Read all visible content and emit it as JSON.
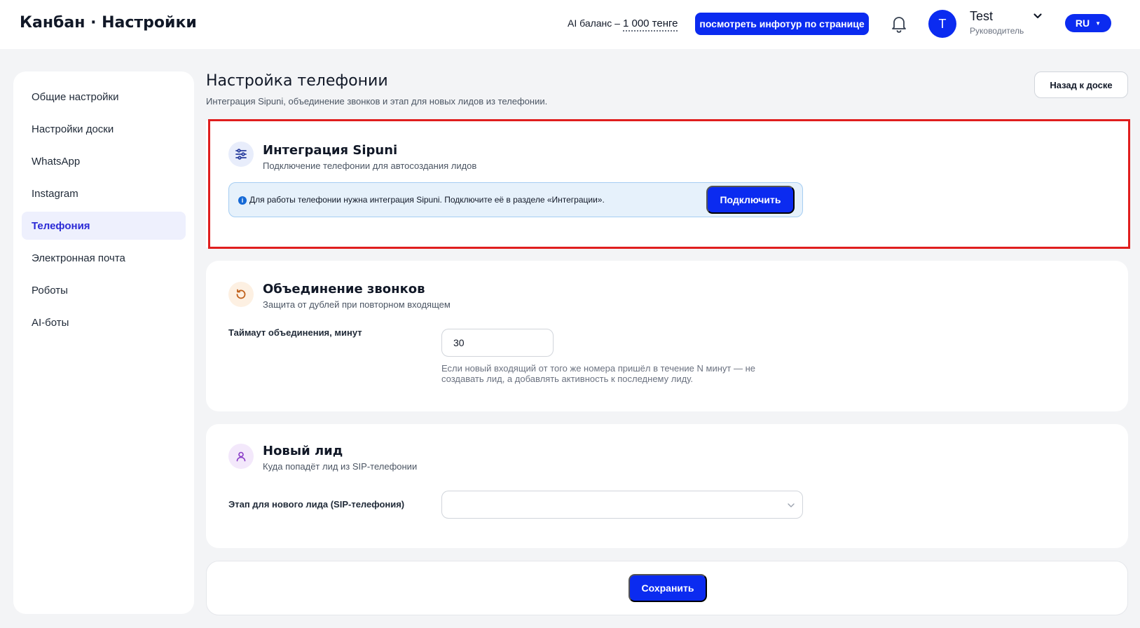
{
  "header": {
    "app_title": "Канбан · Настройки",
    "ai_balance_label": "AI баланс –",
    "ai_balance_value": "1 000 тенге",
    "tour_button": "посмотреть инфотур по странице",
    "user": {
      "initial": "T",
      "name": "Test",
      "role": "Руководитель"
    },
    "language": "RU"
  },
  "sidebar": {
    "items": [
      {
        "label": "Общие настройки"
      },
      {
        "label": "Настройки доски"
      },
      {
        "label": "WhatsApp"
      },
      {
        "label": "Instagram"
      },
      {
        "label": "Телефония",
        "active": true
      },
      {
        "label": "Электронная почта"
      },
      {
        "label": "Роботы"
      },
      {
        "label": "AI-боты"
      }
    ]
  },
  "main": {
    "title": "Настройка телефонии",
    "subtitle": "Интеграция Sipuni, объединение звонков и этап для новых лидов из телефонии.",
    "back_button": "Назад к доске",
    "sipuni": {
      "title": "Интеграция Sipuni",
      "subtitle": "Подключение телефонии для автосоздания лидов",
      "info_text": "Для работы телефонии нужна интеграция Sipuni. Подключите её в разделе «Интеграции».",
      "connect_button": "Подключить"
    },
    "merge": {
      "title": "Объединение звонков",
      "subtitle": "Защита от дублей при повторном входящем",
      "field_label": "Таймаут объединения, минут",
      "value": "30",
      "hint": "Если новый входящий от того же номера пришёл в течение N минут — не создавать лид, а добавлять активность к последнему лиду."
    },
    "new_lead": {
      "title": "Новый лид",
      "subtitle": "Куда попадёт лид из SIP-телефонии",
      "field_label": "Этап для нового лида (SIP-телефония)",
      "selected": ""
    },
    "save_button": "Сохранить"
  },
  "colors": {
    "accent": "#0b2bf0",
    "highlight": "#e01e1e",
    "info_bg": "#e6f1fb"
  },
  "icons": {
    "sipuni": "sliders-icon",
    "merge": "refresh-icon",
    "lead": "user-icon",
    "bell": "bell-icon"
  }
}
